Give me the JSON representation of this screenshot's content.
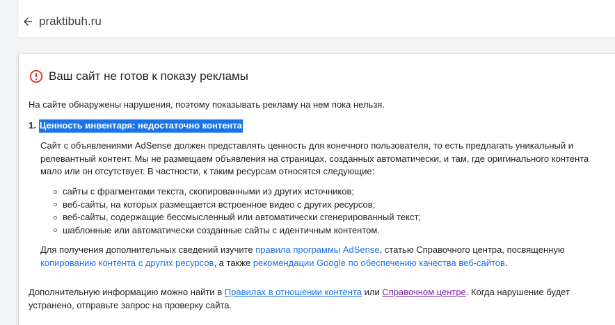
{
  "header": {
    "site_name": "praktibuh.ru"
  },
  "card": {
    "title": "Ваш сайт не готов к показу рекламы",
    "intro": "На сайте обнаружены нарушения, поэтому показывать рекламу на нем пока нельзя.",
    "issue": {
      "number": "1.",
      "label": "Ценность инвентаря: недостаточно контента",
      "description": "Сайт с объявлениями AdSense должен представлять ценность для конечного пользователя, то есть предлагать уникальный и релевантный контент. Мы не размещаем объявления на страницах, созданных автоматически, и там, где оригинального контента мало или он отсутствует. В частности, к таким ресурсам относятся следующие:",
      "bullets": [
        "сайты с фрагментами текста, скопированными из других источников;",
        "веб-сайты, на которых размещается встроенное видео с других ресурсов;",
        "веб-сайты, содержащие бессмысленный или автоматически сгенерированный текст;",
        "шаблонные или автоматически созданные сайты с идентичным контентом."
      ],
      "more": {
        "text1": "Для получения дополнительных сведений изучите ",
        "link1": "правила программы AdSense",
        "text2": ", статью Справочного центра, посвященную ",
        "link2": "копированию контента с других ресурсов",
        "text3": ", а также ",
        "link3": "рекомендации Google по обеспечению качества веб-сайтов",
        "text4": "."
      }
    },
    "footer": {
      "text1": "Дополнительную информацию можно найти в ",
      "link1": "Правилах в отношении контента",
      "text2": " или ",
      "link2": "Справочном центре",
      "text3": ". Когда нарушение будет устранено, отправьте запрос на проверку сайта."
    }
  },
  "colors": {
    "alert": "#d93025",
    "link": "#1a73e8",
    "visited_link": "#7b1fa2",
    "selection": "#1a73e8"
  }
}
